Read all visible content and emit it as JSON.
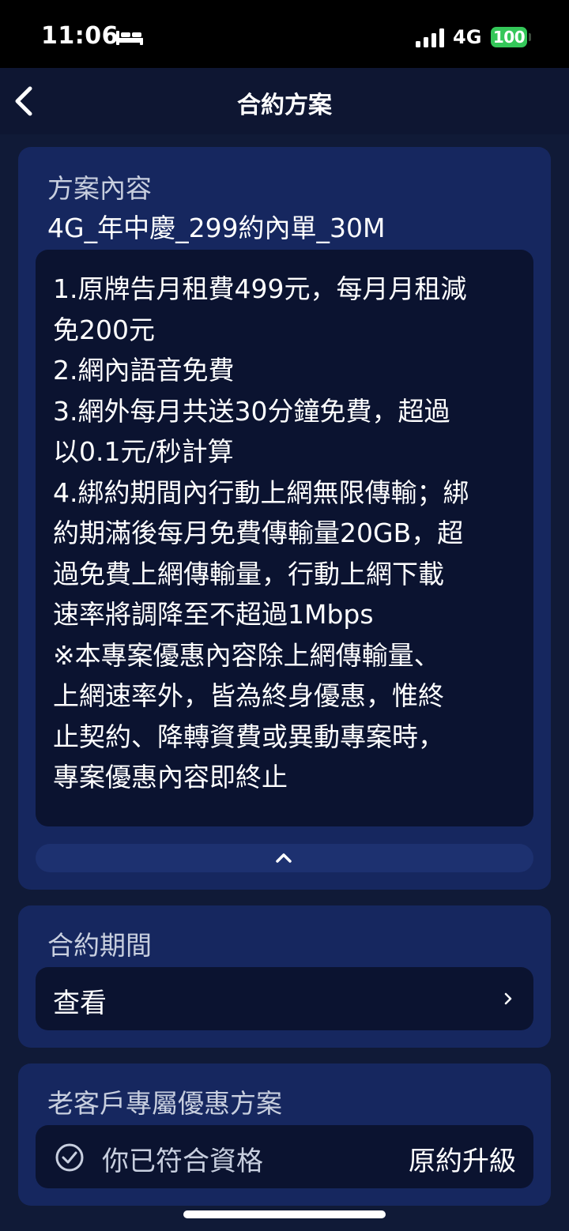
{
  "status_bar": {
    "time": "11:06",
    "network": "4G",
    "battery": "100",
    "icons": [
      "bed-icon",
      "signal-icon"
    ]
  },
  "nav": {
    "title": "合約方案",
    "back_icon": "chevron-left-icon"
  },
  "plan": {
    "section_label": "方案內容",
    "name": "4G_年中慶_299約內單_30M",
    "details": "1.原牌告月租費499元，每月月租減\n免200元\n2.網內語音免費\n3.網外每月共送30分鐘免費，超過\n以0.1元/秒計算\n4.綁約期間內行動上網無限傳輸；綁\n約期滿後每月免費傳輸量20GB，超\n過免費上網傳輸量，行動上網下載\n速率將調降至不超過1Mbps\n※本專案優惠內容除上網傳輸量、\n上網速率外，皆為終身優惠，惟終\n止契約、降轉資費或異動專案時，\n專案優惠內容即終止",
    "collapse_icon": "chevron-up-icon"
  },
  "contract": {
    "section_label": "合約期間",
    "view_label": "查看",
    "view_icon": "chevron-right-icon"
  },
  "loyalty": {
    "section_label": "老客戶專屬優惠方案",
    "eligible_label": "你已符合資格",
    "upgrade_label": "原約升級",
    "check_icon": "check-circle-icon"
  },
  "colors": {
    "background": "#101a37",
    "card": "#16275f",
    "inner_box": "#0b1330",
    "battery": "#34c759"
  }
}
